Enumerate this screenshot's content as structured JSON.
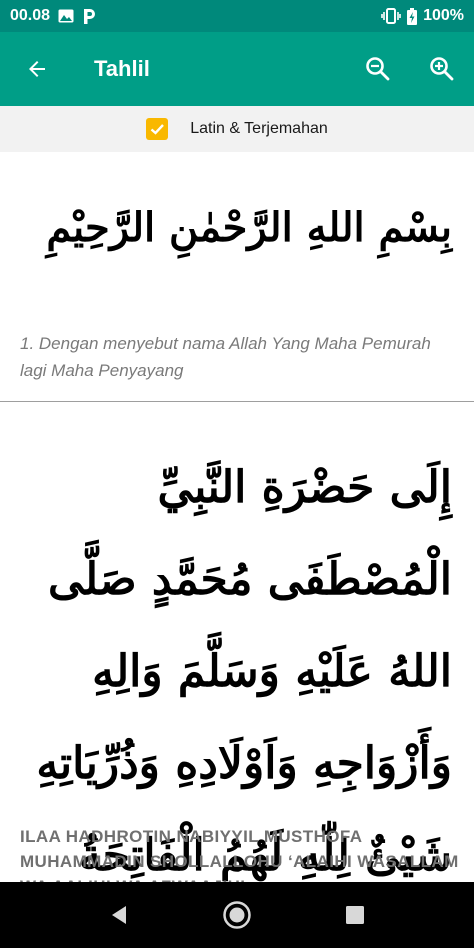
{
  "status_bar": {
    "time": "00.08",
    "battery": "100%",
    "icons": [
      "image-icon",
      "parking-icon",
      "vibrate-icon",
      "battery-charging-icon"
    ]
  },
  "app_bar": {
    "title": "Tahlil",
    "icons": [
      "back-arrow-icon",
      "zoom-out-icon",
      "zoom-in-icon"
    ],
    "color": "#009e87"
  },
  "option": {
    "label": "Latin & Terjemahan",
    "checked": true,
    "checkbox_color": "#f9b800"
  },
  "sections": [
    {
      "arabic": "بِسْمِ اللهِ الرَّحْمٰنِ الرَّحِيْمِ",
      "translation": "1. Dengan menyebut nama Allah Yang Maha Pemurah lagi Maha Penyayang"
    },
    {
      "arabic": "إِلَى حَضْرَةِ النَّبِيِّ الْمُصْطَفَى مُحَمَّدٍ صَلَّى اللهُ عَلَيْهِ وَسَلَّمَ وَالِهِ وَأَزْوَاجِهِ وَاَوْلَادِهِ وَذُرِّيَاتِهِ شَيْئٌ لِلّٰهِ لَهُمُ الْفَاتِحَةُ",
      "latin": "ILAA HADHROTIN NABIYYIL MUSTHOFA MUHAMMADIN SHOLLALLOHU ‘ALAIHI WASALLAM WA AALIHI WA AZWAAJIHI"
    }
  ],
  "nav_bar": {
    "icons": [
      "back-triangle-icon",
      "home-circle-icon",
      "recents-square-icon"
    ]
  }
}
